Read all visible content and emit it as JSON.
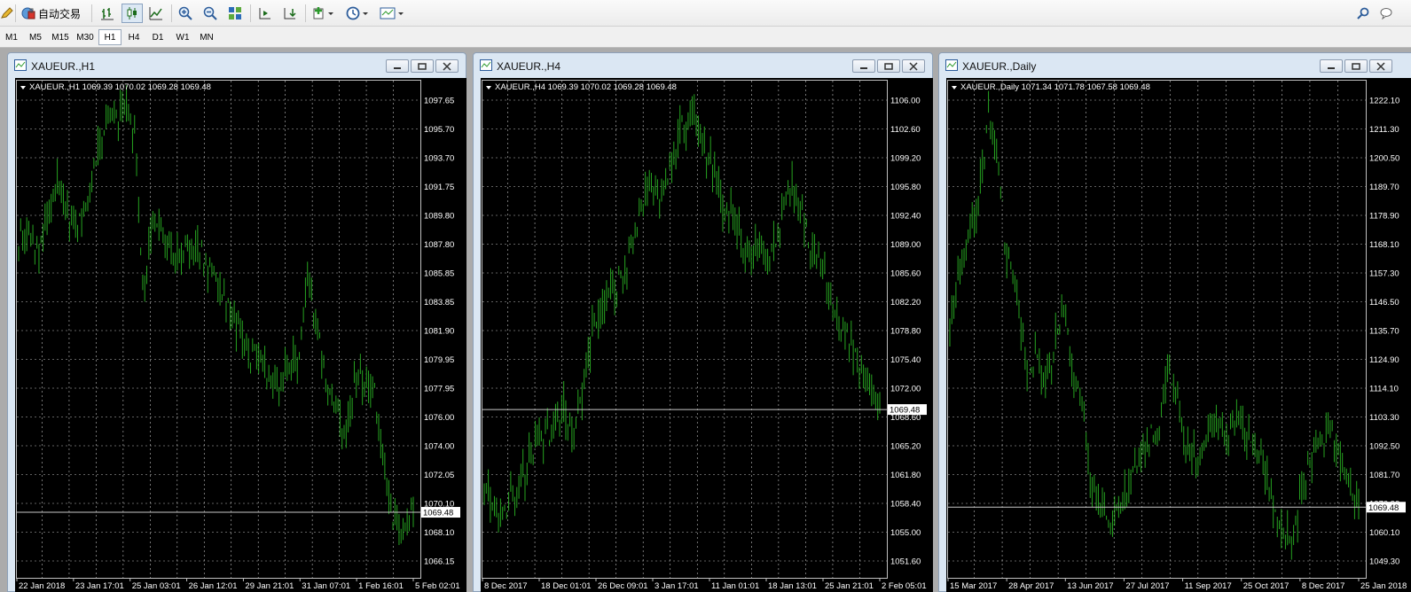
{
  "toolbar": {
    "autotrade_label": "自动交易"
  },
  "periods": [
    "M1",
    "M5",
    "M15",
    "M30",
    "H1",
    "H4",
    "D1",
    "W1",
    "MN"
  ],
  "active_period": "H1",
  "colors": {
    "chart_bg": "#000000",
    "grid": "#c0c0c0",
    "bars": "#26a320",
    "axis_text": "#ffffff"
  },
  "windows": [
    {
      "title": "XAUEUR.,H1",
      "header": "XAUEUR.,H1  1069.39 1070.02 1069.28 1069.48",
      "price_label": "1069.48",
      "y_labels": [
        "1097.65",
        "1095.70",
        "1093.70",
        "1091.75",
        "1089.80",
        "1087.80",
        "1085.85",
        "1083.85",
        "1081.90",
        "1079.95",
        "1077.95",
        "1076.00",
        "1074.00",
        "1072.05",
        "1070.10",
        "1068.10",
        "1066.15"
      ],
      "x_labels": [
        "22 Jan 2018",
        "23 Jan 17:01",
        "25 Jan 03:01",
        "26 Jan 12:01",
        "29 Jan 21:01",
        "31 Jan 07:01",
        "1 Feb 16:01",
        "5 Feb 02:01"
      ]
    },
    {
      "title": "XAUEUR.,H4",
      "header": "XAUEUR.,H4  1069.39 1070.02 1069.28 1069.48",
      "price_label": "1069.48",
      "y_labels": [
        "1106.00",
        "1102.60",
        "1099.20",
        "1095.80",
        "1092.40",
        "1089.00",
        "1085.60",
        "1082.20",
        "1078.80",
        "1075.40",
        "1072.00",
        "1068.60",
        "1065.20",
        "1061.80",
        "1058.40",
        "1055.00",
        "1051.60"
      ],
      "x_labels": [
        "8 Dec 2017",
        "18 Dec 01:01",
        "26 Dec 09:01",
        "3 Jan 17:01",
        "11 Jan 01:01",
        "18 Jan 13:01",
        "25 Jan 21:01",
        "2 Feb 05:01"
      ]
    },
    {
      "title": "XAUEUR.,Daily",
      "header": "XAUEUR.,Daily  1071.34 1071.78 1067.58 1069.48",
      "price_label": "1069.48",
      "y_labels": [
        "1222.10",
        "1211.30",
        "1200.50",
        "1189.70",
        "1178.90",
        "1168.10",
        "1157.30",
        "1146.50",
        "1135.70",
        "1124.90",
        "1114.10",
        "1103.30",
        "1092.50",
        "1081.70",
        "1070.90",
        "1060.10",
        "1049.30"
      ],
      "x_labels": [
        "15 Mar 2017",
        "28 Apr 2017",
        "13 Jun 2017",
        "27 Jul 2017",
        "11 Sep 2017",
        "25 Oct 2017",
        "8 Dec 2017",
        "25 Jan 2018"
      ]
    }
  ],
  "chart_data": [
    {
      "type": "bar",
      "title": "XAUEUR.,H1",
      "ylim": [
        1066.15,
        1097.65
      ],
      "last_price": 1069.48,
      "close_path": [
        1088,
        1089,
        1087,
        1089.5,
        1092,
        1090,
        1089,
        1090.5,
        1094,
        1096,
        1096.5,
        1097,
        1095.5,
        1084,
        1090,
        1088,
        1087.5,
        1086.5,
        1088,
        1087,
        1086,
        1085,
        1083,
        1082,
        1080,
        1080.5,
        1079,
        1078,
        1080,
        1079.5,
        1085,
        1082,
        1078,
        1076,
        1075,
        1079,
        1078.5,
        1077.5,
        1072,
        1069,
        1068,
        1069.48
      ],
      "x_labels": [
        "22 Jan 2018",
        "23 Jan 17:01",
        "25 Jan 03:01",
        "26 Jan 12:01",
        "29 Jan 21:01",
        "31 Jan 07:01",
        "1 Feb 16:01",
        "5 Feb 02:01"
      ],
      "grid": true
    },
    {
      "type": "bar",
      "title": "XAUEUR.,H4",
      "ylim": [
        1051.6,
        1106.0
      ],
      "last_price": 1069.48,
      "close_path": [
        1061,
        1057,
        1058,
        1060,
        1063,
        1067,
        1066,
        1070,
        1067,
        1072,
        1080,
        1083,
        1084,
        1087,
        1092,
        1096,
        1094,
        1098,
        1103,
        1104,
        1101,
        1097,
        1093,
        1091,
        1087,
        1089,
        1087,
        1091,
        1096,
        1092,
        1088,
        1085,
        1081,
        1078,
        1076,
        1072,
        1069.48
      ],
      "x_labels": [
        "8 Dec 2017",
        "18 Dec 01:01",
        "26 Dec 09:01",
        "3 Jan 17:01",
        "11 Jan 01:01",
        "18 Jan 13:01",
        "25 Jan 21:01",
        "2 Feb 05:01"
      ],
      "grid": true
    },
    {
      "type": "bar",
      "title": "XAUEUR.,Daily",
      "ylim": [
        1049.3,
        1222.1
      ],
      "last_price": 1069.48,
      "close_path": [
        1140,
        1160,
        1170,
        1185,
        1215,
        1200,
        1165,
        1150,
        1120,
        1125,
        1118,
        1130,
        1145,
        1120,
        1105,
        1075,
        1070,
        1065,
        1068,
        1080,
        1090,
        1095,
        1100,
        1120,
        1110,
        1090,
        1088,
        1095,
        1100,
        1098,
        1103,
        1098,
        1093,
        1085,
        1070,
        1060,
        1057,
        1075,
        1085,
        1095,
        1100,
        1090,
        1080,
        1069.48
      ],
      "x_labels": [
        "15 Mar 2017",
        "28 Apr 2017",
        "13 Jun 2017",
        "27 Jul 2017",
        "11 Sep 2017",
        "25 Oct 2017",
        "8 Dec 2017",
        "25 Jan 2018"
      ],
      "grid": true
    }
  ]
}
